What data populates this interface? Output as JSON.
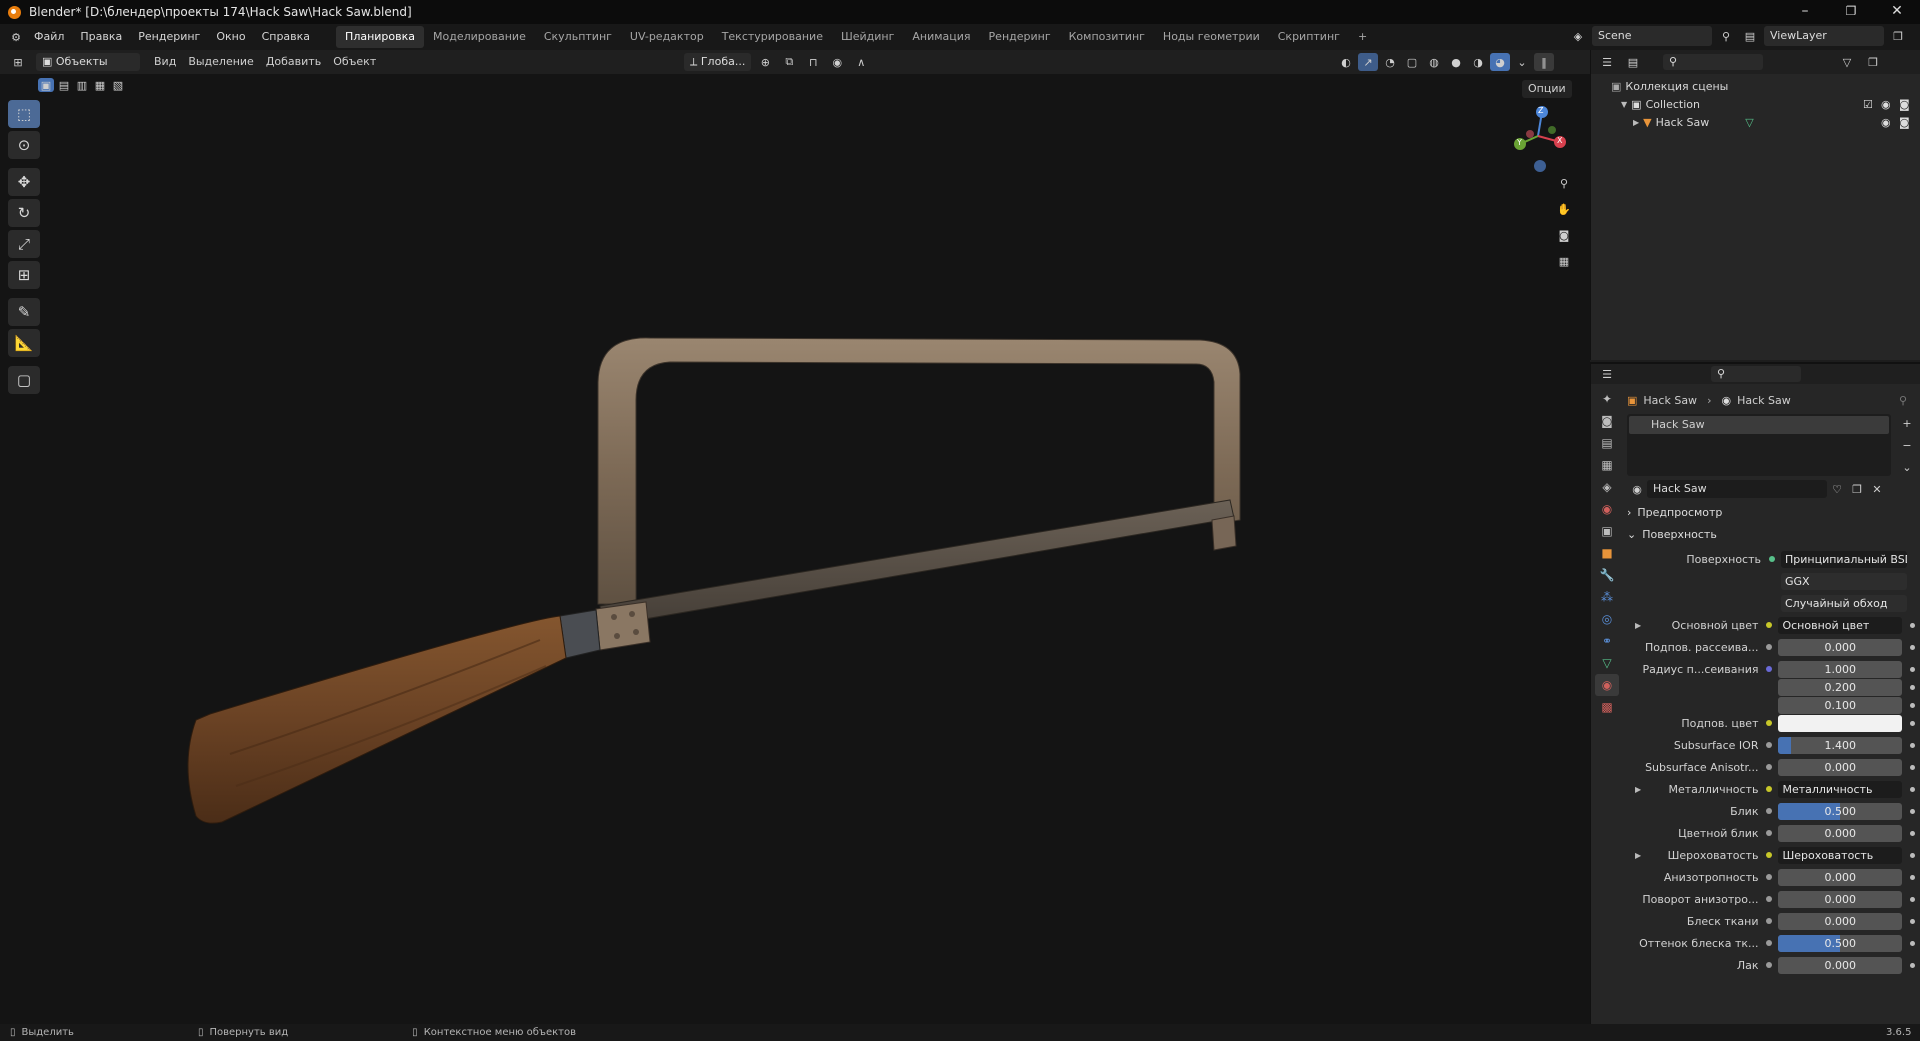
{
  "window": {
    "title": "Blender* [D:\\блендер\\проекты 174\\Hack Saw\\Hack Saw.blend]",
    "controls": [
      "–",
      "❐",
      "✕"
    ]
  },
  "menu": [
    "Файл",
    "Правка",
    "Рендеринг",
    "Окно",
    "Справка"
  ],
  "workspaces": [
    "Планировка",
    "Моделирование",
    "Скульптинг",
    "UV-редактор",
    "Текстурирование",
    "Шейдинг",
    "Анимация",
    "Рендеринг",
    "Композитинг",
    "Ноды геометрии",
    "Скриптинг"
  ],
  "workspace_add": "+",
  "scene": {
    "name": "Scene",
    "view_layer": "ViewLayer"
  },
  "viewport_header": {
    "mode": "Объекты",
    "menus": [
      "Вид",
      "Выделение",
      "Добавить",
      "Объект"
    ],
    "orientation": "Глоба...",
    "options": "Опции"
  },
  "gizmo": {
    "z": "Z",
    "y": "Y",
    "x": "X"
  },
  "outliner": {
    "scene_collection": "Коллекция сцены",
    "collection": "Collection",
    "object": "Hack Saw"
  },
  "properties": {
    "breadcrumb": [
      "Hack Saw",
      "Hack Saw"
    ],
    "slot": "Hack Saw",
    "material_name": "Hack Saw",
    "panel_preview": "Предпросмотр",
    "panel_surface": "Поверхность",
    "surface_label": "Поверхность",
    "surface_value": "Принципиальный BSDF",
    "distribution": "GGX",
    "subsurface_method": "Случайный обход",
    "rows": [
      {
        "label": "Основной цвет",
        "type": "link",
        "value": "Основной цвет",
        "expand": true
      },
      {
        "label": "Подпов. рассеива...",
        "type": "num",
        "value": "0.000",
        "fill": 0
      },
      {
        "label": "Радиус п...сеивания",
        "type": "num",
        "value": "1.000",
        "fill": 0
      },
      {
        "label": "",
        "type": "num",
        "value": "0.200",
        "fill": 0
      },
      {
        "label": "",
        "type": "num",
        "value": "0.100",
        "fill": 0
      },
      {
        "label": "Подпов. цвет",
        "type": "color",
        "value": "",
        "color": "#f2f2f2"
      },
      {
        "label": "Subsurface IOR",
        "type": "num",
        "value": "1.400",
        "fill": 0.1
      },
      {
        "label": "Subsurface Anisotr...",
        "type": "num",
        "value": "0.000",
        "fill": 0
      },
      {
        "label": "Металличность",
        "type": "link",
        "value": "Металличность",
        "expand": true
      },
      {
        "label": "Блик",
        "type": "num",
        "value": "0.500",
        "fill": 0.5
      },
      {
        "label": "Цветной блик",
        "type": "num",
        "value": "0.000",
        "fill": 0
      },
      {
        "label": "Шероховатость",
        "type": "link",
        "value": "Шероховатость",
        "expand": true
      },
      {
        "label": "Анизотропность",
        "type": "num",
        "value": "0.000",
        "fill": 0
      },
      {
        "label": "Поворот анизотро...",
        "type": "num",
        "value": "0.000",
        "fill": 0
      },
      {
        "label": "Блеск ткани",
        "type": "num",
        "value": "0.000",
        "fill": 0
      },
      {
        "label": "Оттенок блеска тк...",
        "type": "num",
        "value": "0.500",
        "fill": 0.5
      },
      {
        "label": "Лак",
        "type": "num",
        "value": "0.000",
        "fill": 0
      }
    ]
  },
  "status": {
    "select": "Выделить",
    "rotate": "Повернуть вид",
    "context": "Контекстное меню объектов",
    "version": "3.6.5"
  },
  "colors": {
    "accent": "#4772b3",
    "wood": "#6e4526",
    "metal": "#8a7560"
  }
}
